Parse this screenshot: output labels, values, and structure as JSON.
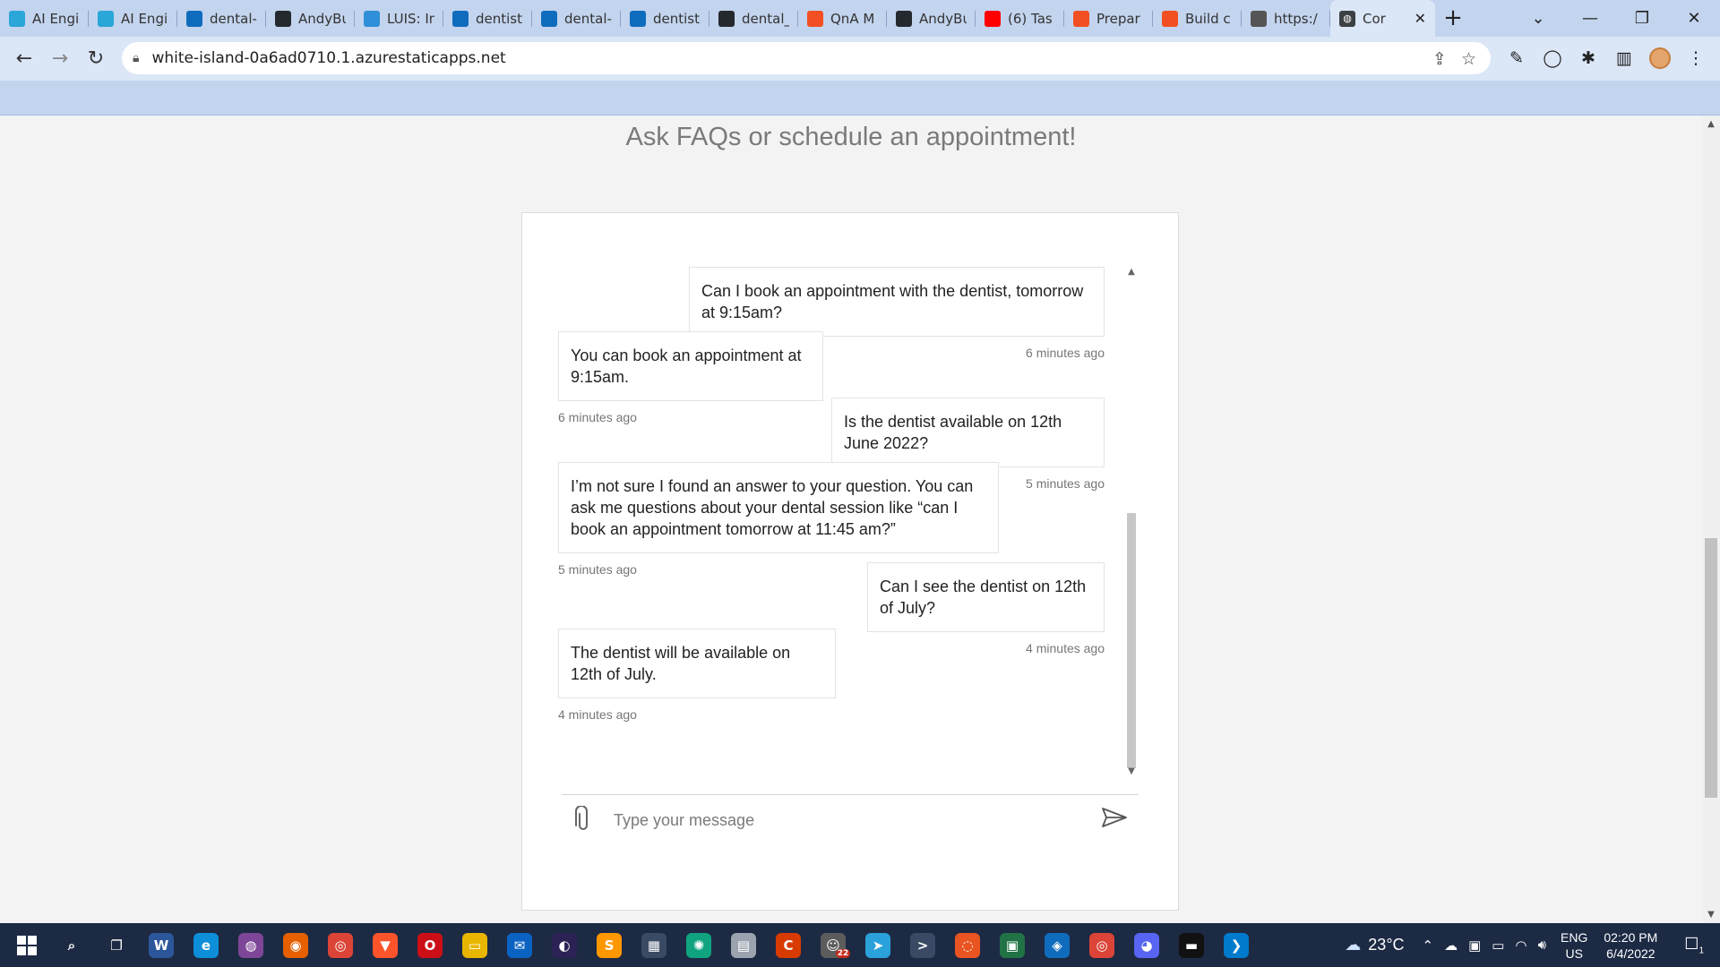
{
  "browser": {
    "tabs": [
      {
        "title": "AI Engi",
        "icon": "teal-bookmark-icon",
        "color": "#2aa6d8"
      },
      {
        "title": "AI Engi",
        "icon": "teal-bookmark-icon",
        "color": "#2aa6d8"
      },
      {
        "title": "dental-",
        "icon": "azure-icon",
        "color": "#0f6cbd"
      },
      {
        "title": "AndyBu",
        "icon": "github-icon",
        "color": "#24292e"
      },
      {
        "title": "LUIS: In",
        "icon": "luis-icon",
        "color": "#2f8fd8"
      },
      {
        "title": "dentist",
        "icon": "azure-icon",
        "color": "#0f6cbd"
      },
      {
        "title": "dental-",
        "icon": "azure-icon",
        "color": "#0f6cbd"
      },
      {
        "title": "dentist",
        "icon": "azure-icon",
        "color": "#0f6cbd"
      },
      {
        "title": "dental_",
        "icon": "github-icon",
        "color": "#24292e"
      },
      {
        "title": "QnA M",
        "icon": "microsoft-icon",
        "color": "#f25022"
      },
      {
        "title": "AndyBu",
        "icon": "github-icon",
        "color": "#24292e"
      },
      {
        "title": "(6) Tas",
        "icon": "youtube-icon",
        "color": "#ff0000"
      },
      {
        "title": "Prepar",
        "icon": "microsoft-icon",
        "color": "#f25022"
      },
      {
        "title": "Build c",
        "icon": "microsoft-icon",
        "color": "#f25022"
      },
      {
        "title": "https:/",
        "icon": "globe-icon",
        "color": "#555555"
      }
    ],
    "active_tab": {
      "title": "Cor",
      "icon": "globe-icon"
    },
    "url": "white-island-0a6ad0710.1.azurestaticapps.net"
  },
  "page": {
    "tagline": "Ask FAQs or schedule an appointment!",
    "input_placeholder": "Type your message"
  },
  "messages": [
    {
      "role": "user",
      "text": "Can I book an appointment with the dentist, tomorrow at 9:15am?",
      "time": "6 minutes ago"
    },
    {
      "role": "bot",
      "text": "You can book an appointment at 9:15am.",
      "time": "6 minutes ago"
    },
    {
      "role": "user",
      "text": "Is the dentist available on 12th June 2022?",
      "time": "5 minutes ago"
    },
    {
      "role": "bot",
      "text": "I’m not sure I found an answer to your question. You can ask me questions about your dental session like “can I book an appointment tomorrow at 11:45 am?”",
      "time": "5 minutes ago"
    },
    {
      "role": "user",
      "text": "Can I see the dentist on 12th of July?",
      "time": "4 minutes ago"
    },
    {
      "role": "bot",
      "text": "The dentist will be available on 12th of July.",
      "time": "4 minutes ago"
    }
  ],
  "taskbar": {
    "weather": "23°C",
    "lang_top": "ENG",
    "lang_bottom": "US",
    "time": "02:20 PM",
    "date": "6/4/2022",
    "notif_count": "1",
    "badge_count": "22",
    "apps": [
      {
        "name": "search-icon",
        "color": "#1d2a44",
        "glyph": "⌕"
      },
      {
        "name": "task-view-icon",
        "color": "#1d2a44",
        "glyph": "❐"
      },
      {
        "name": "word-icon",
        "color": "#2b579a",
        "glyph": "W"
      },
      {
        "name": "edge-icon",
        "color": "#0c8ed9",
        "glyph": "e"
      },
      {
        "name": "tor-icon",
        "color": "#7d4698",
        "glyph": "◍"
      },
      {
        "name": "firefox-icon",
        "color": "#e66000",
        "glyph": "◉"
      },
      {
        "name": "chrome-icon",
        "color": "#db4437",
        "glyph": "◎"
      },
      {
        "name": "brave-icon",
        "color": "#fb542b",
        "glyph": "▼"
      },
      {
        "name": "opera-icon",
        "color": "#cc0f16",
        "glyph": "O"
      },
      {
        "name": "file-explorer-icon",
        "color": "#e8b600",
        "glyph": "▭"
      },
      {
        "name": "mail-icon",
        "color": "#0a63c2",
        "glyph": "✉"
      },
      {
        "name": "eclipse-icon",
        "color": "#2c2255",
        "glyph": "◐"
      },
      {
        "name": "sublime-icon",
        "color": "#ff9800",
        "glyph": "S"
      },
      {
        "name": "calculator-icon",
        "color": "#3b4a64",
        "glyph": "▦"
      },
      {
        "name": "chatgpt-icon",
        "color": "#10a37f",
        "glyph": "✺"
      },
      {
        "name": "book-icon",
        "color": "#9ba3af",
        "glyph": "▤"
      },
      {
        "name": "office-icon",
        "color": "#d83b01",
        "glyph": "C"
      },
      {
        "name": "chat-badge-icon",
        "color": "#5c5c5c",
        "glyph": "☺"
      },
      {
        "name": "telegram-icon",
        "color": "#2aa1da",
        "glyph": "➤"
      },
      {
        "name": "terminal-icon",
        "color": "#3b4a64",
        "glyph": ">"
      },
      {
        "name": "ubuntu-icon",
        "color": "#e95420",
        "glyph": "◌"
      },
      {
        "name": "sheet-icon",
        "color": "#217346",
        "glyph": "▣"
      },
      {
        "name": "remote-icon",
        "color": "#0f6cbd",
        "glyph": "◈"
      },
      {
        "name": "chrome-active-icon",
        "color": "#db4437",
        "glyph": "◎"
      },
      {
        "name": "discord-icon",
        "color": "#5865f2",
        "glyph": "◕"
      },
      {
        "name": "cmd-icon",
        "color": "#111111",
        "glyph": "▬"
      },
      {
        "name": "vscode-icon",
        "color": "#007acc",
        "glyph": "❯"
      }
    ]
  }
}
